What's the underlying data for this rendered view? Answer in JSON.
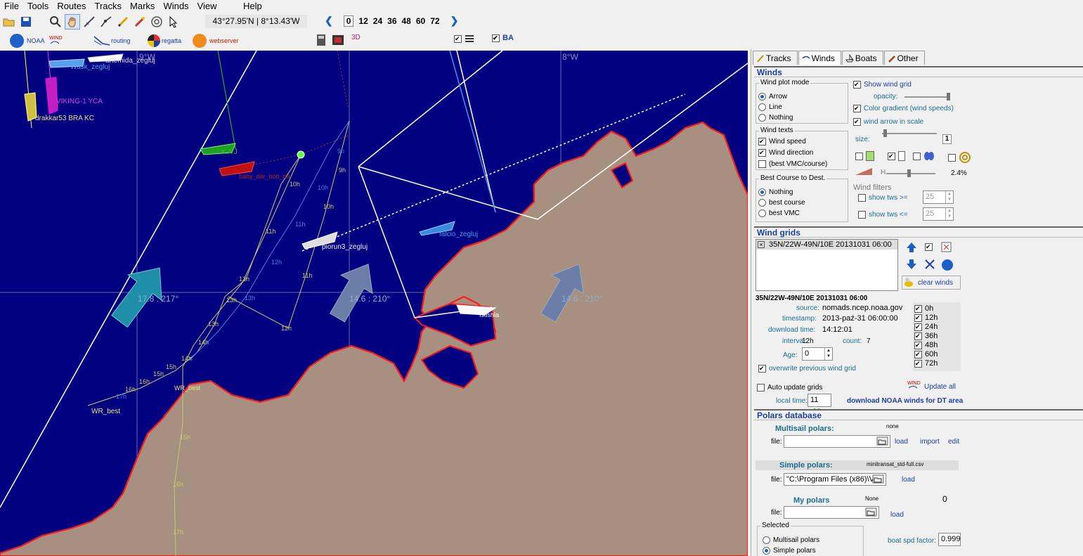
{
  "menu": [
    "File",
    "Tools",
    "Routes",
    "Tracks",
    "Marks",
    "Winds",
    "View",
    "Help"
  ],
  "toolbar": {
    "coords": "43°27.95'N | 8°13.43'W",
    "hours": [
      "0",
      "12",
      "24",
      "36",
      "48",
      "60",
      "72"
    ]
  },
  "toolbar2": {
    "noaa": "NOAA",
    "routing": "routing",
    "regatta": "regatta",
    "webserver": "webserver",
    "three_d": "3D",
    "ba": "BA"
  },
  "map": {
    "meridians": [
      "9°W",
      "8°W"
    ],
    "wind_labels": [
      "17.8 : 217°",
      "14.6 : 210°",
      "14.6 : 210°"
    ],
    "boats": [
      "Wask_zegluj",
      "artemida_zegluj",
      "VIKING-1 YCA",
      "drakkar53 BRA KC",
      "K A J",
      "piorun3_zegluj",
      "falcio_zegluj",
      "Istishla",
      "WR_best",
      "WR_best",
      "baby_dar_bob_na"
    ],
    "hour_marks_a": [
      "9h",
      "9h",
      "10h",
      "10h",
      "10h",
      "11h",
      "11h",
      "11h",
      "12h",
      "12h",
      "12h",
      "13h",
      "13h",
      "13h",
      "14h",
      "14h",
      "15h",
      "15h",
      "16h",
      "16h",
      "17h",
      "18h",
      "19h",
      "15h",
      "16h",
      "17h"
    ]
  },
  "tabs": [
    "Tracks",
    "Winds",
    "Boats",
    "Other"
  ],
  "winds": {
    "title": "Winds",
    "plot_mode_title": "Wind plot mode",
    "plot_modes": [
      "Arrow",
      "Line",
      "Nothing"
    ],
    "wind_texts_title": "Wind texts",
    "wind_texts": [
      "Wind speed",
      "Wind direction",
      "(best VMC/course)"
    ],
    "best_course_title": "Best Course to Dest.",
    "best_course": [
      "Nothing",
      "best course",
      "best VMC"
    ],
    "show_wind_grid": "Show wind grid",
    "opacity": "opacity:",
    "color_gradient": "Color gradient (wind speeds)",
    "wind_arrow_scale": "wind arrow in scale",
    "size": "size:",
    "size_val": "1",
    "percent": "2.4%",
    "filters_title": "Wind filters",
    "tws_ge": "show tws >=",
    "tws_le": "show tws <=",
    "tws_ge_val": "25",
    "tws_le_val": "25",
    "h_label": "H"
  },
  "grids": {
    "title": "Wind grids",
    "grid_item": "35N/22W-49N/10E 20131031 06:00",
    "clear": "clear winds",
    "header": "35N/22W-49N/10E 20131031 06:00",
    "source_k": "source:",
    "source_v": "nomads.ncep.noaa.gov",
    "timestamp_k": "timestamp:",
    "timestamp_v": "2013-paź-31 06:00:00",
    "download_k": "download time:",
    "download_v": "14:12:01",
    "interval_k": "interval:",
    "interval_v": "12h",
    "count_k": "count:",
    "count_v": "7",
    "age_k": "Age:",
    "age_v": "0",
    "overwrite": "overwrite previous wind grid",
    "hours": [
      "0h",
      "12h",
      "24h",
      "36h",
      "48h",
      "60h",
      "72h"
    ],
    "auto_update": "Auto update grids",
    "update_all": "Update all",
    "local_time_k": "local time:",
    "local_time_v": "11 :00",
    "download_noaa": "download NOAA winds for DT area"
  },
  "polars": {
    "title": "Polars database",
    "multisail": "Multisail polars:",
    "multisail_val": "none",
    "file_k": "file:",
    "load": "load",
    "import": "import",
    "edit": "edit",
    "simple": "Simple polars:",
    "simple_val": "minitransat_std-full.csv",
    "simple_file": "\"C:\\Program Files (x86)\\V",
    "my": "My polars",
    "my_val": "None",
    "my_num": "0",
    "selected": "Selected",
    "sel_multi": "Multisail polars",
    "sel_simple": "Simple polars",
    "spd_factor": "boat spd factor:",
    "spd_val": "0.999"
  },
  "colors": {
    "sea": "#000080",
    "land": "#a89080",
    "coast": "#ff1a1a",
    "accent": "#1b3fa3"
  }
}
